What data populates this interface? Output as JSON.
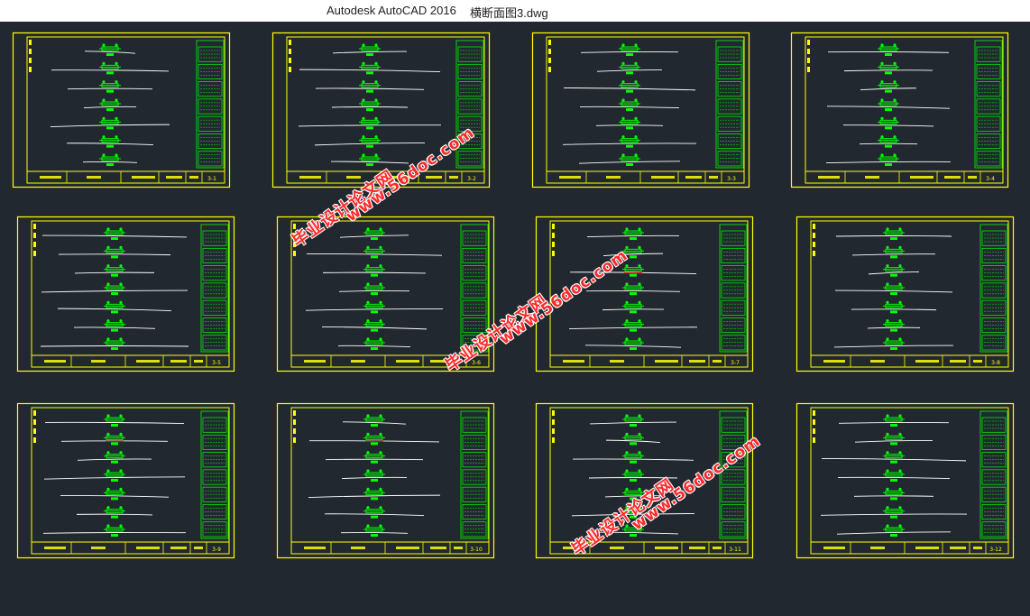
{
  "window": {
    "app_title": "Autodesk AutoCAD 2016",
    "file_name": "横断面图3.dwg"
  },
  "colors": {
    "background": "#212830",
    "frame": "#ffff00",
    "geometry": "#00ff00",
    "ground_line": "#ffffff",
    "accent_red": "#ff0000",
    "watermark": "#ff2b2b"
  },
  "sheets": [
    {
      "id": "3-1",
      "label": "3-1"
    },
    {
      "id": "3-2",
      "label": "3-2"
    },
    {
      "id": "3-3",
      "label": "3-3"
    },
    {
      "id": "3-4",
      "label": "3-4"
    },
    {
      "id": "3-5",
      "label": "3-5"
    },
    {
      "id": "3-6",
      "label": "3-6"
    },
    {
      "id": "3-7",
      "label": "3-7"
    },
    {
      "id": "3-8",
      "label": "3-8"
    },
    {
      "id": "3-9",
      "label": "3-9"
    },
    {
      "id": "3-10",
      "label": "3-10"
    },
    {
      "id": "3-11",
      "label": "3-11"
    },
    {
      "id": "3-12",
      "label": "3-12"
    }
  ],
  "watermarks": [
    {
      "text": "毕业设计论文网",
      "kind": "cn"
    },
    {
      "text": "www.56doc.com",
      "kind": "url"
    },
    {
      "text": "毕业设计论文网",
      "kind": "cn"
    },
    {
      "text": "www.56doc.com",
      "kind": "url"
    },
    {
      "text": "毕业设计论文网",
      "kind": "cn"
    },
    {
      "text": "www.56doc.com",
      "kind": "url"
    }
  ]
}
